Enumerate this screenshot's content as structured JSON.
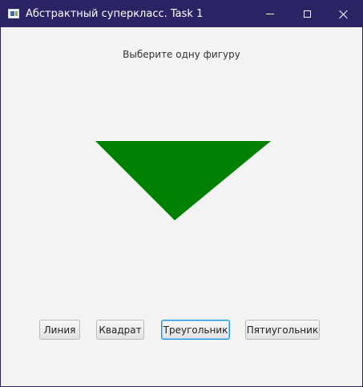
{
  "window": {
    "title": "Абстрактный суперкласс. Task 1"
  },
  "prompt": "Выберите одну фигуру",
  "shape": {
    "type": "triangle",
    "fill": "#008000"
  },
  "buttons": {
    "line": "Линия",
    "square": "Квадрат",
    "triangle": "Треугольник",
    "pentagon": "Пятиугольник"
  },
  "colors": {
    "titlebar": "#2a2464",
    "background": "#f3f3f4",
    "focus_border": "#1f93d8"
  }
}
